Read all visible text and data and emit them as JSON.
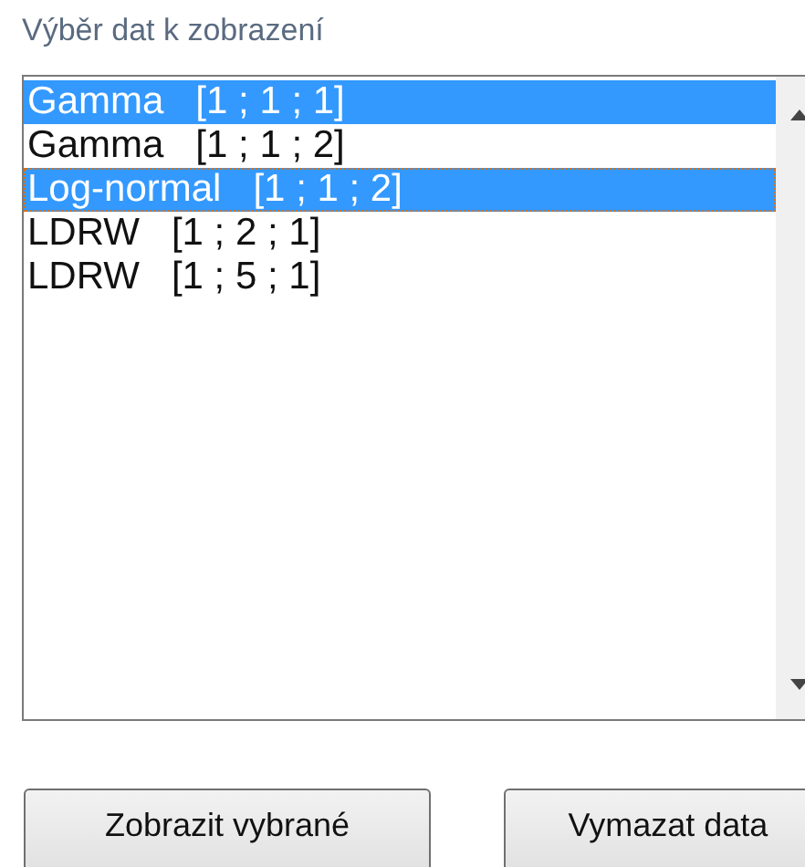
{
  "label": "Výběr dat k zobrazení",
  "list": {
    "items": [
      {
        "name": "Gamma",
        "params": "[1 ; 1 ; 1]",
        "selected": true,
        "focused": false
      },
      {
        "name": "Gamma",
        "params": "[1 ; 1 ; 2]",
        "selected": false,
        "focused": false
      },
      {
        "name": "Log-normal",
        "params": "[1 ; 1 ; 2]",
        "selected": true,
        "focused": true
      },
      {
        "name": "LDRW",
        "params": "[1 ; 2 ; 1]",
        "selected": false,
        "focused": false
      },
      {
        "name": "LDRW",
        "params": "[1 ; 5 ; 1]",
        "selected": false,
        "focused": false
      }
    ]
  },
  "buttons": [
    "Zobrazit vybrané",
    "Vymazat data"
  ]
}
